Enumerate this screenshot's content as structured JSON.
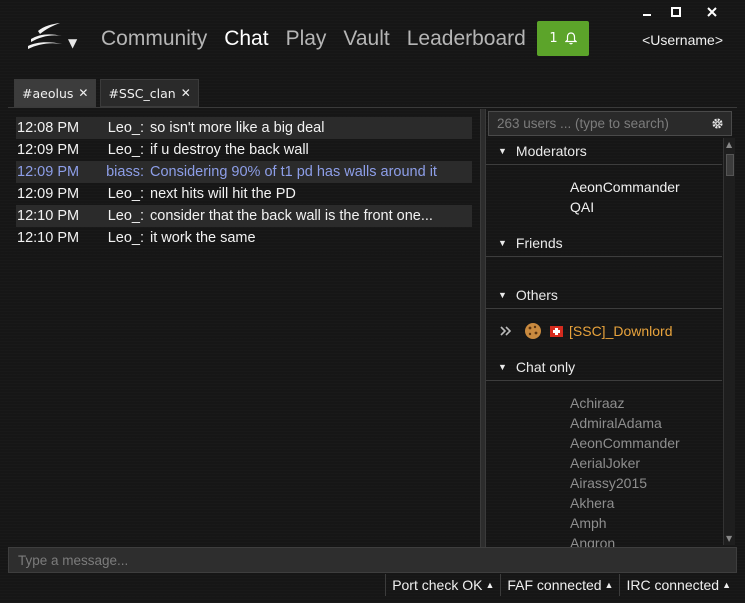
{
  "nav": {
    "items": [
      "Community",
      "Chat",
      "Play",
      "Vault",
      "Leaderboard"
    ],
    "active": "Chat"
  },
  "notification": {
    "count": "1",
    "icon": "bell-icon"
  },
  "user": {
    "name": "<Username>"
  },
  "tabs": [
    {
      "label": "#aeolus",
      "active": true
    },
    {
      "label": "#SSC_clan",
      "active": false
    }
  ],
  "messages": [
    {
      "time": "12:08 PM",
      "nick": "Leo_:",
      "text": "so isn't more like a big deal"
    },
    {
      "time": "12:09 PM",
      "nick": "Leo_:",
      "text": "if u destroy the back wall"
    },
    {
      "time": "12:09 PM",
      "nick": "biass:",
      "text": "Considering 90% of t1 pd has walls around it"
    },
    {
      "time": "12:09 PM",
      "nick": "Leo_:",
      "text": "next hits will hit the PD"
    },
    {
      "time": "12:10 PM",
      "nick": "Leo_:",
      "text": "consider that the back wall is the front one..."
    },
    {
      "time": "12:10 PM",
      "nick": "Leo_:",
      "text": "it work the same"
    }
  ],
  "userlist": {
    "search_placeholder": "263 users ... (type to search)",
    "groups": {
      "moderators": "Moderators",
      "friends": "Friends",
      "others": "Others",
      "chat_only": "Chat only"
    },
    "moderators": [
      "AeonCommander",
      "QAI"
    ],
    "others": [
      {
        "name": "[SSC]_Downlord",
        "flag": "Switzerland",
        "color": "#e8a33c"
      }
    ],
    "chat_only": [
      "Achiraaz",
      "AdmiralAdama",
      "AeonCommander",
      "AerialJoker",
      "Airassy2015",
      "Akhera",
      "Amph",
      "Angron"
    ]
  },
  "input": {
    "placeholder": "Type a message..."
  },
  "status": {
    "port": "Port check OK",
    "faf": "FAF connected",
    "irc": "IRC connected"
  },
  "colors": {
    "accent_green": "#5ca42a",
    "highlight_blue": "#8d9ee8",
    "clan_orange": "#e8a33c"
  }
}
